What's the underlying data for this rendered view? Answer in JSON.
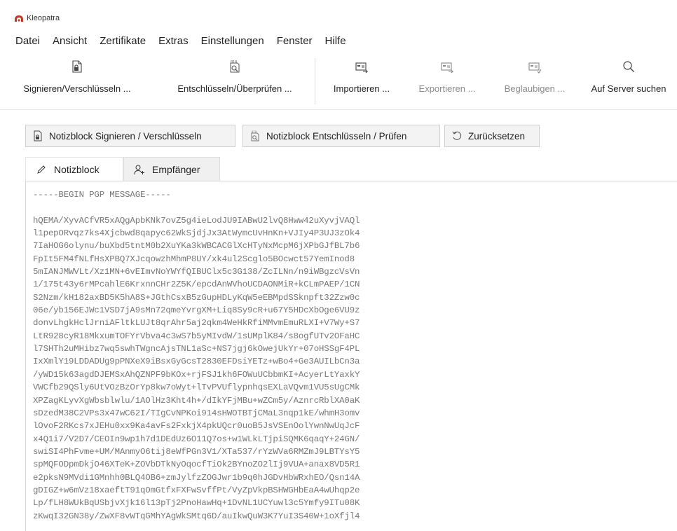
{
  "window": {
    "title": "Kleopatra"
  },
  "menu": [
    "Datei",
    "Ansicht",
    "Zertifikate",
    "Extras",
    "Einstellungen",
    "Fenster",
    "Hilfe"
  ],
  "toolbar": {
    "sign_encrypt": "Signieren/Verschlüsseln ...",
    "decrypt_verify": "Entschlüsseln/Überprüfen ...",
    "import": "Importieren ...",
    "export": "Exportieren ...",
    "certify": "Beglaubigen ...",
    "lookup": "Auf Server suchen"
  },
  "notepad_actions": {
    "sign_encrypt": "Notizblock Signieren / Verschlüsseln",
    "decrypt_verify": "Notizblock Entschlüsseln / Prüfen",
    "reset": "Zurücksetzen"
  },
  "tabs": {
    "notepad": "Notizblock",
    "recipients": "Empfänger"
  },
  "colors": {
    "accent": "#c0392b",
    "disabled_text": "#8a8a8a"
  },
  "notepad_text": "-----BEGIN PGP MESSAGE-----\n\nhQEMA/XyvACfVR5xAQgApbKNk7ovZ5g4ieLodJU9IABwU2lvQ8Hww42uXyvjVAQl\nl1pepORvqz7ks4Xjcbwd8qapyc62WkSjdjJx3AtWymcUvHnKn+VJIy4P3UJ3zOk4\n7IaHOG6olynu/buXbd5tntM0b2XuYKa3kWBCACGlXcHTyNxMcpM6jXPbGJfBL7b6\nFpIt5FM4fNLfHsXPBQ7XJcqowzhMhmP8UY/xk4ul2Scglo5BOcwct57YemInod8\n5mIANJMWVLt/Xz1MN+6vEImvNoYWYfQIBUClx5c3G138/ZcILNn/n9iWBgzcVsVn\n1/175t43y6rMPcahlE6KrxnnCHr2Z5K/epcdAnWVhoUCDAONMiR+kCLmPAEP/1CN\nS2Nzm/kH182axBD5K5hA8S+JGthCsxB5zGupHDLyKqW5eEBMpdSSknpft32Zzw0c\n06e/yb156EJWc1VSD7jA9sMn72qmeYvrgXM+Liq8Sy9cR+u67Y5HDcXbOge6VU9z\ndonvLhgkHclJrniAFltkLUJt8qrAhr5aj2qkm4WeHkRfiMMvmEmuRLXI+V7Wy+S7\nLtR928cyR18MkxumTOFYrVbva4c3wS7b5yMIvdW/1sUMplK84/s8ogfUTv2OFaHC\nl7SHTh2uMHibz7wq5swhTWgncAjsTNL1aSc+NS7jgj6kOwejUkYr+07oHSSgF4PL\nIxXmlY19LDDADUg9pPNXeX9iBsxGyGcsT2830EFDsiYETz+wBo4+Ge3AUILbCn3a\n/yWD15k63agdDJEMSxAhQZNPF9bKOx+rjFSJ1kh6FOWuUCbbmKI+AcyerLtYaxkY\nVWCfb29QSly6UtVOzBzOrYp8kw7oWyt+lTvPVUflypnhqsEXLaVQvm1VU5sUgCMk\nXPZagKLyvXgWbsblwlu/1AOlHz3Kht4h+/dIkYFjMBu+wZCm5y/AznrcRblXA0aK\nsDzedM38C2VPs3x47wC62I/TIgCvNPKoi914sHWOTBTjCMaL3nqp1kE/whmH3omv\nlOvoF2RKcs7xJEHu0xx9Ka4avFs2FxkjX4pkUQcr0uoB5JsVSEnOolYwnNwUqJcF\nx4Q1i7/V2D7/CEOIn9wp1h7d1DEdUz6O11Q7os+w1WLkLTjpiSQMK6qaqY+24GN/\nswiSI4PhFvme+UM/MAnmyO6tij8eWfPGn3V1/XTa537/rYzWVa6RMZmJ9LBTYsY5\nspMQFODpmDkjO46XTeK+ZOVbDTkNyOqocfTiOk2BYnoZO2lIj9VUA+anax8VD5R1\ne2pksN9MVdi1GMnhh0BLQ4OB6+zmJylfzZOGJwr1b9q0hJGDvHbWRxhEO/Qsn14A\ngDIGZ+w6mVz18xaeftT91qOmGtfxFXFwSvffPt/VyZpVkpBSHWGHbEaA4wUhqp2e\nLp/fLH8WUkBqUSbjvXjk16l13pTj2PnoHawHq+1DvNL1UCYuwl3c5Ymfy9ITu08K\nzKwqI32GN38y/ZwXF8vWTqGMhYAgWkSMtq6D/auIkwQuW3K7YuI3S40W+1oXfjl4"
}
